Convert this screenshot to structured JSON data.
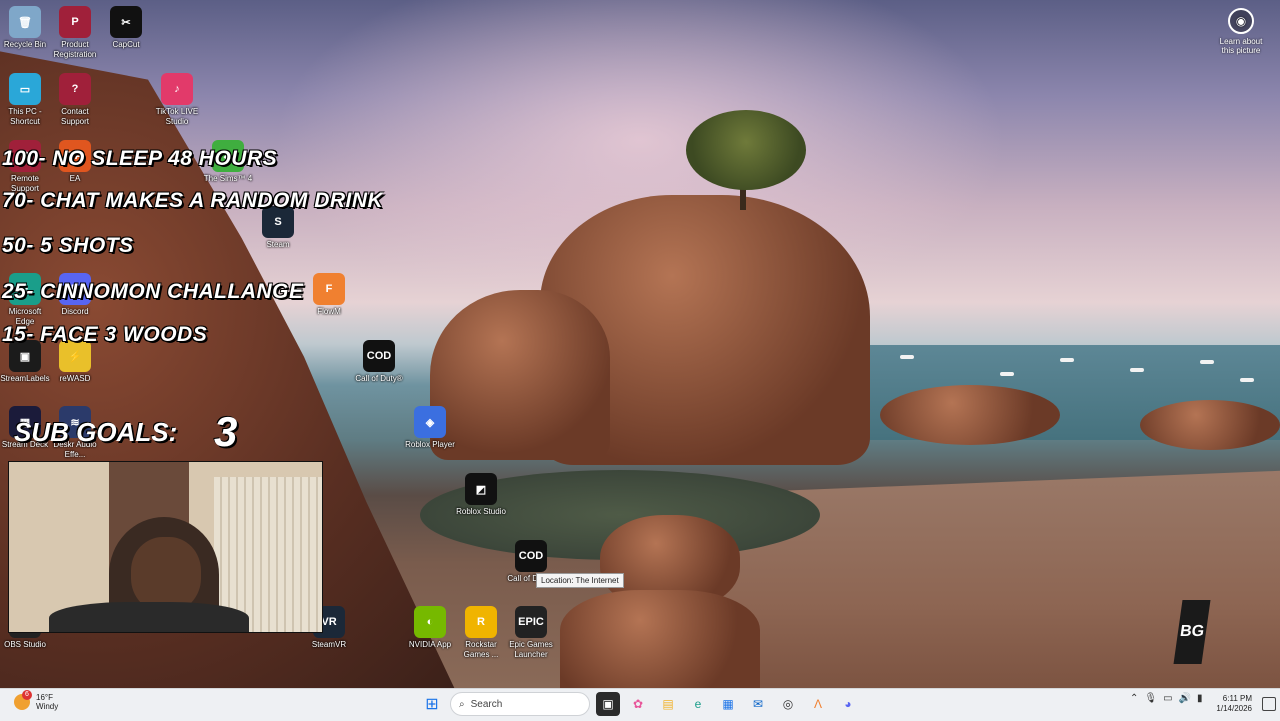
{
  "desktop_icons": [
    {
      "label": "Recycle Bin",
      "glyph": "🗑",
      "color": "#7fa7c9"
    },
    {
      "label": "Product Registration",
      "glyph": "P",
      "color": "#a0203a"
    },
    {
      "label": "CapCut",
      "glyph": "✂",
      "color": "#111111"
    },
    {
      "label": "This PC - Shortcut",
      "glyph": "▭",
      "color": "#2aa7d8"
    },
    {
      "label": "Contact Support",
      "glyph": "?",
      "color": "#a0203a"
    },
    {
      "label": "TikTok LIVE Studio",
      "glyph": "♪",
      "color": "#e23a6a"
    },
    {
      "label": "Remote Support",
      "glyph": "R",
      "color": "#a0203a"
    },
    {
      "label": "EA",
      "glyph": "EA",
      "color": "#e0561f"
    },
    {
      "label": "The Sims™ 4",
      "glyph": "◆",
      "color": "#3fae3f"
    },
    {
      "label": "Steam",
      "glyph": "S",
      "color": "#1b2838"
    },
    {
      "label": "Microsoft Edge",
      "glyph": "e",
      "color": "#1a9e8a"
    },
    {
      "label": "Discord",
      "glyph": "D",
      "color": "#5865f2"
    },
    {
      "label": "FlowM",
      "glyph": "F",
      "color": "#f08030"
    },
    {
      "label": "Call of Duty®",
      "glyph": "COD",
      "color": "#111111"
    },
    {
      "label": "StreamLabels",
      "glyph": "▣",
      "color": "#1b1b1b"
    },
    {
      "label": "reWASD",
      "glyph": "⚡",
      "color": "#e9c02a"
    },
    {
      "label": "Roblox Player",
      "glyph": "◈",
      "color": "#3b6fe0"
    },
    {
      "label": "Stream Deck",
      "glyph": "▦",
      "color": "#1b1b3a"
    },
    {
      "label": "Deskr Audio Effe...",
      "glyph": "≋",
      "color": "#2b3a6a"
    },
    {
      "label": "Roblox Studio",
      "glyph": "◩",
      "color": "#111111"
    },
    {
      "label": "Call of Duty®",
      "glyph": "COD",
      "color": "#111111"
    },
    {
      "label": "OBS Studio",
      "glyph": "◎",
      "color": "#222222"
    },
    {
      "label": "SteamVR",
      "glyph": "VR",
      "color": "#1b2838"
    },
    {
      "label": "NVIDIA App",
      "glyph": "◐",
      "color": "#76b900"
    },
    {
      "label": "Rockstar Games ...",
      "glyph": "R",
      "color": "#f0b400"
    },
    {
      "label": "Epic Games Launcher",
      "glyph": "EPIC",
      "color": "#222222"
    }
  ],
  "overlay_goals": [
    "100- NO SLEEP 48 HOURS",
    "70- CHAT MAKES A RANDOM DRINK",
    "50- 5 SHOTS",
    "25- CINNOMON CHALLANGE",
    "15- FACE 3 WOODS"
  ],
  "sub_goals": {
    "label": "SUB GOALS:",
    "count": "3"
  },
  "tooltip": "Location: The Internet",
  "learn_picture": "Learn about this picture",
  "brand_logo": "BG",
  "taskbar": {
    "weather_temp": "16°F",
    "weather_desc": "Windy",
    "weather_badge": "6",
    "search_placeholder": "Search",
    "time": "6:11 PM",
    "date": "1/14/2026"
  }
}
